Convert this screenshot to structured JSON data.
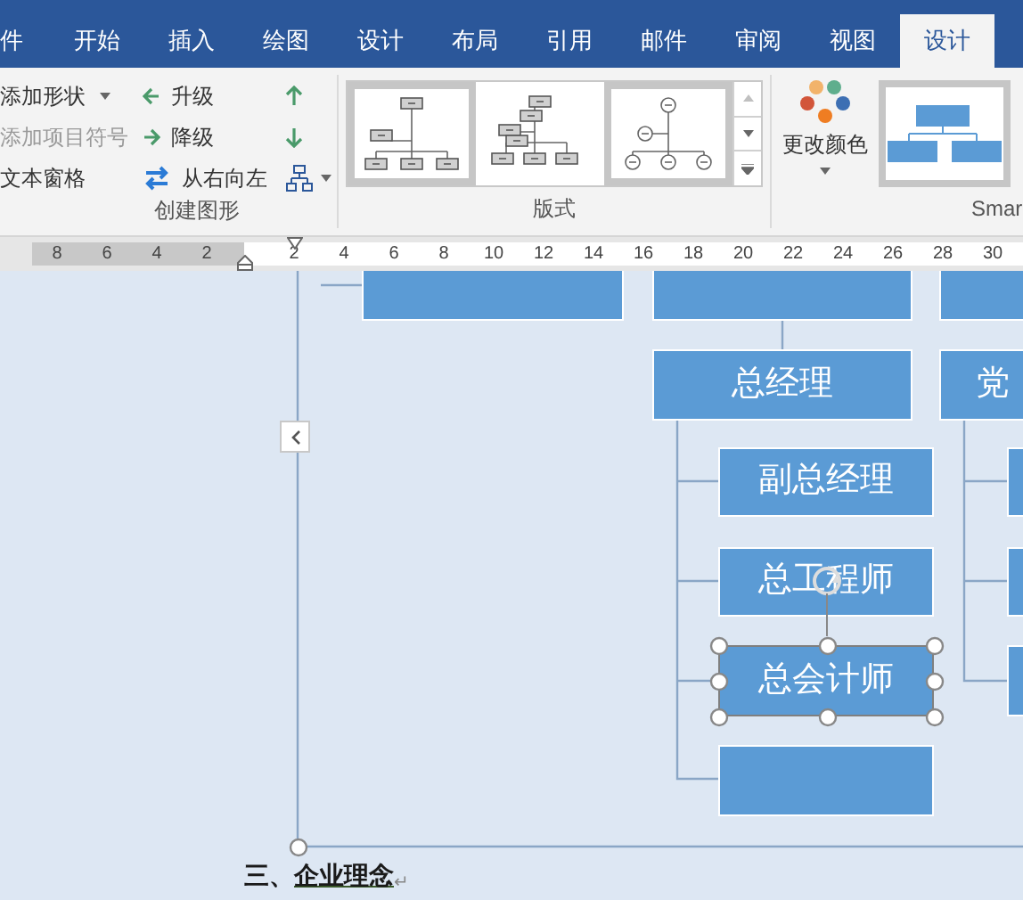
{
  "tabs": [
    {
      "label": "件",
      "selected": false
    },
    {
      "label": "开始",
      "selected": false
    },
    {
      "label": "插入",
      "selected": false
    },
    {
      "label": "绘图",
      "selected": false
    },
    {
      "label": "设计",
      "selected": false
    },
    {
      "label": "布局",
      "selected": false
    },
    {
      "label": "引用",
      "selected": false
    },
    {
      "label": "邮件",
      "selected": false
    },
    {
      "label": "审阅",
      "selected": false
    },
    {
      "label": "视图",
      "selected": false
    },
    {
      "label": "设计",
      "selected": true
    }
  ],
  "create_group": {
    "label": "创建图形",
    "commands": [
      {
        "label": "添加形状",
        "dropdown": true,
        "disabled": false
      },
      {
        "label": "添加项目符号",
        "dropdown": false,
        "disabled": true
      },
      {
        "label": "文本窗格",
        "dropdown": false,
        "disabled": false
      }
    ],
    "arrange": [
      {
        "kind": "promote",
        "label": "升级"
      },
      {
        "kind": "demote",
        "label": "降级"
      },
      {
        "kind": "rtl",
        "label": "从右向左"
      }
    ],
    "move": [
      {
        "kind": "up"
      },
      {
        "kind": "down"
      },
      {
        "kind": "layout"
      }
    ]
  },
  "layouts_group": {
    "label": "版式",
    "layouts": [
      {
        "kind": "org",
        "selected": true
      },
      {
        "kind": "hierarchy",
        "selected": false
      },
      {
        "kind": "circle",
        "selected": true
      }
    ]
  },
  "color_button": {
    "label": "更改颜色"
  },
  "styles_group": {
    "label": "Smar"
  },
  "ruler": {
    "left_numbers": [
      "8",
      "6",
      "4",
      "2"
    ],
    "numbers": [
      "2",
      "4",
      "6",
      "8",
      "10",
      "12",
      "14",
      "16",
      "18",
      "20",
      "22",
      "24",
      "26",
      "28",
      "30"
    ]
  },
  "diagram": {
    "nodes": [
      {
        "selected": false
      },
      {
        "selected": false
      },
      {
        "selected": false
      },
      {
        "text": "总经理",
        "selected": false
      },
      {
        "text": "党",
        "selected": false
      },
      {
        "text": "副总经理",
        "selected": false
      },
      {
        "text": "总工程师",
        "selected": false
      },
      {
        "text": "总会计师",
        "selected": true
      },
      {
        "selected": false
      },
      {
        "selected": false
      },
      {
        "selected": false
      },
      {
        "selected": false
      }
    ]
  },
  "paragraph": {
    "number": "三、",
    "text": "企业理念",
    "mark": "↵"
  }
}
